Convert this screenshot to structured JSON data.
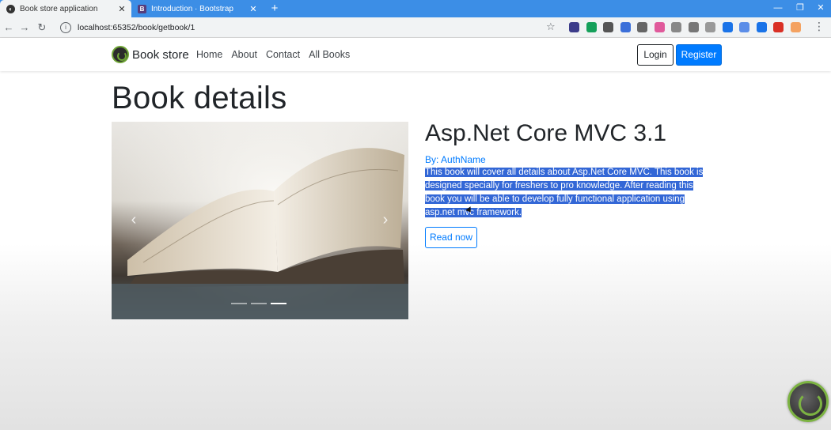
{
  "browser": {
    "tabs": [
      {
        "title": "Book store application",
        "close": "✕"
      },
      {
        "title": "Introduction · Bootstrap",
        "close": "✕",
        "favicon": "B"
      }
    ],
    "new_tab": "+",
    "url": "localhost:65352/book/getbook/1",
    "extension_colors": [
      "#3c3c8a",
      "#15a05a",
      "#555",
      "#3b6fd9",
      "#666",
      "#e05a9b",
      "#888",
      "#777",
      "#999",
      "#1a73e8",
      "#5b8de8",
      "#1a73e8",
      "#d93025",
      "#f4a261"
    ]
  },
  "navbar": {
    "brand": "Book store",
    "links": [
      "Home",
      "About",
      "Contact",
      "All Books"
    ],
    "login": "Login",
    "register": "Register"
  },
  "page": {
    "title": "Book details"
  },
  "carousel": {
    "prev_icon": "‹",
    "next_icon": "›",
    "slide_count": 3,
    "active_index": 2
  },
  "book": {
    "title": "Asp.Net Core MVC 3.1",
    "author": "By: AuthName",
    "description": "This book will cover all details about Asp.Net Core MVC. This book is designed specially for freshers to pro knowledge. After reading this book you will be able to develop fully functional application using asp.net mvc framework.",
    "read_button": "Read now"
  }
}
